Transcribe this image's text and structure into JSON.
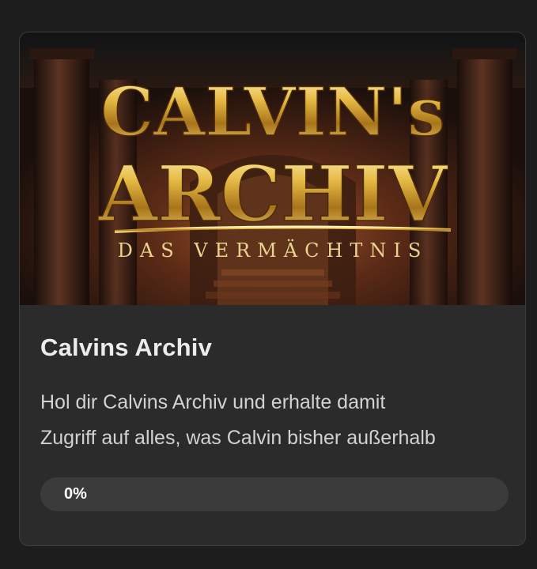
{
  "course": {
    "banner_logo": {
      "line1": "CALVIN's",
      "line2": "ARCHIV",
      "subtitle": "DAS VERMÄCHTNIS"
    },
    "title": "Calvins Archiv",
    "description_line1": "Hol dir Calvins Archiv und erhalte damit",
    "description_line2": "Zugriff auf alles, was Calvin bisher außerhalb",
    "progress": {
      "percent": 0,
      "label": "0%"
    }
  },
  "colors": {
    "page_bg": "#1d1d1d",
    "card_bg": "#2b2b2b",
    "track": "#3b3b3b",
    "gold": "#d4a93a"
  }
}
